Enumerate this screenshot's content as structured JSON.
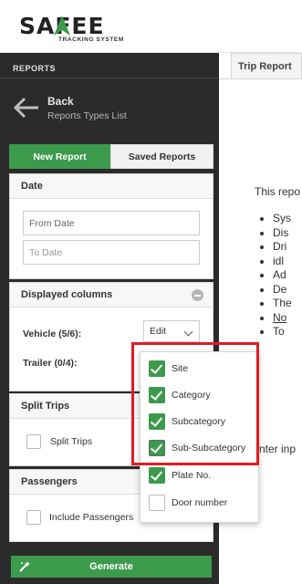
{
  "header": {
    "logo_word": "SAFEE",
    "logo_sub": "TRACKING SYSTEM",
    "brand_color": "#3c9a4c"
  },
  "sidebar": {
    "title": "REPORTS",
    "back_label": "Back",
    "back_sub": "Reports Types List",
    "tabs": [
      {
        "label": "New Report",
        "active": true
      },
      {
        "label": "Saved Reports",
        "active": false
      }
    ],
    "date_panel": {
      "title": "Date",
      "from_placeholder": "From Date",
      "to_placeholder": "To Date"
    },
    "columns_panel": {
      "title": "Displayed columns",
      "vehicle_label": "Vehicle (5/6):",
      "trailer_label": "Trailer (0/4):",
      "edit_label": "Edit"
    },
    "split_panel": {
      "title": "Split Trips",
      "checkbox_label": "Split Trips"
    },
    "passengers_panel": {
      "title": "Passengers",
      "checkbox_label": "Include Passengers"
    },
    "generate_label": "Generate"
  },
  "main": {
    "tab_label": "Trip Report",
    "intro": "This repo",
    "list": [
      "Sys",
      "Dis",
      "Dri",
      "idl",
      "Ad",
      "De",
      "The",
      "No",
      "To"
    ],
    "enter_text": "nter inp"
  },
  "dropdown": {
    "items": [
      {
        "label": "Site",
        "checked": true
      },
      {
        "label": "Category",
        "checked": true
      },
      {
        "label": "Subcategory",
        "checked": true
      },
      {
        "label": "Sub-Subcategory",
        "checked": true
      },
      {
        "label": "Plate No.",
        "checked": true
      },
      {
        "label": "Door number",
        "checked": false
      }
    ],
    "highlight_color": "#e01b24"
  }
}
